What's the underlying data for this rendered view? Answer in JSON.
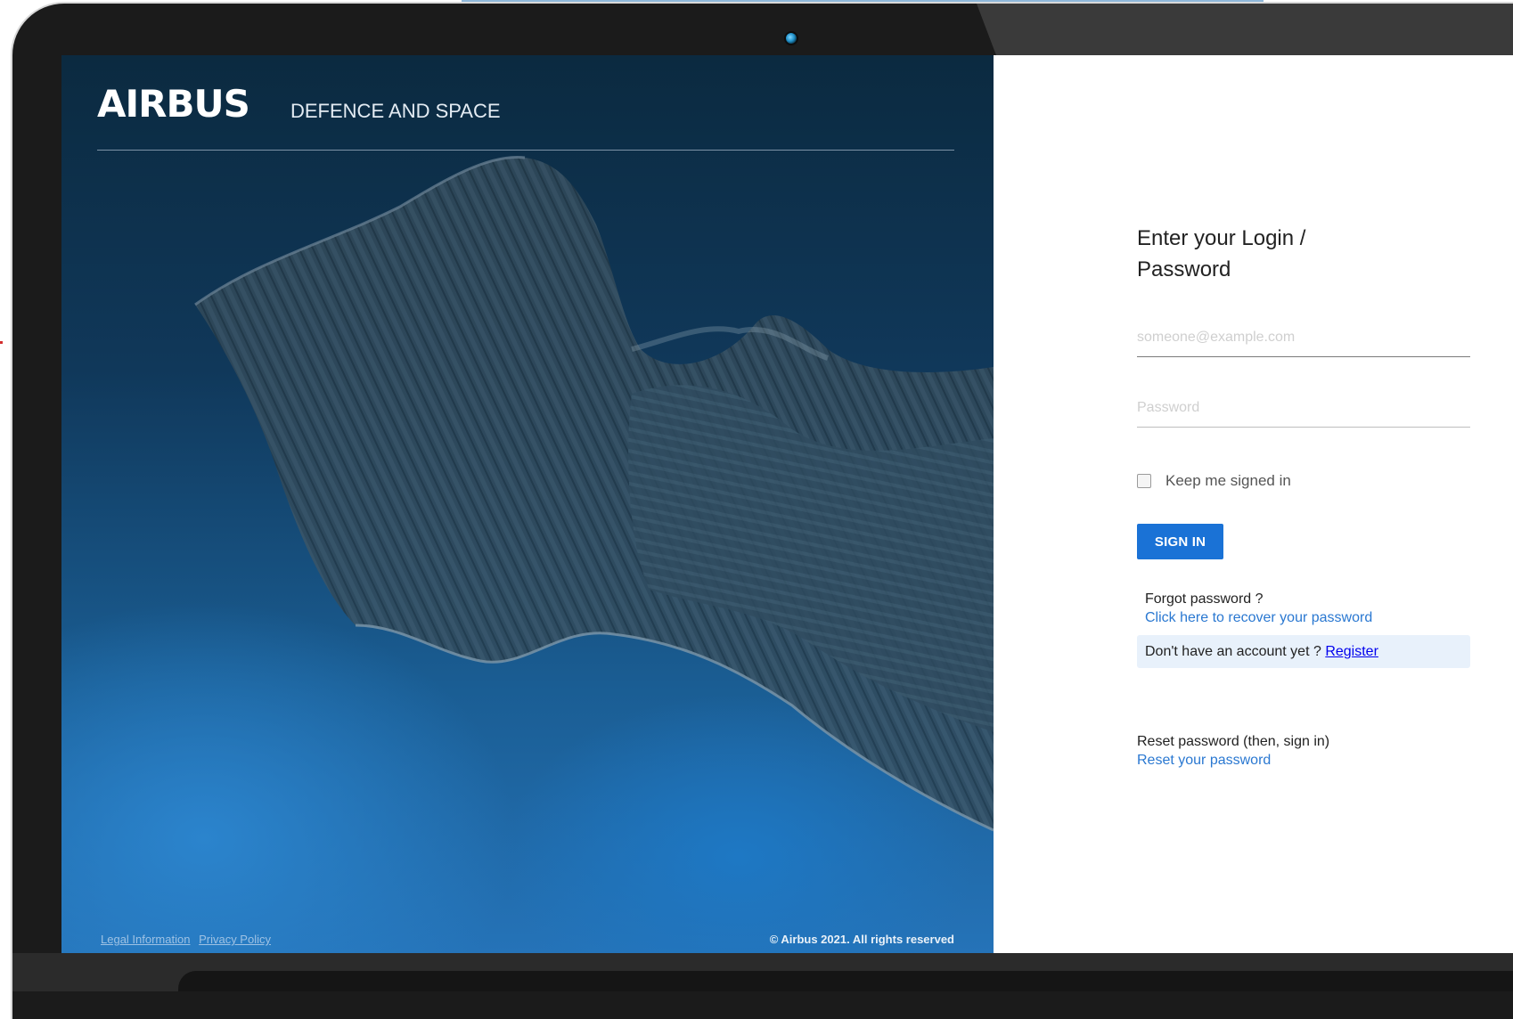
{
  "brand": {
    "logo_text": "AIRBUS",
    "subtitle": "DEFENCE AND SPACE"
  },
  "footer": {
    "legal_label": "Legal Information",
    "privacy_label": "Privacy Policy",
    "copyright": "© Airbus 2021. All rights reserved"
  },
  "login": {
    "title": "Enter your Login / Password",
    "email_placeholder": "someone@example.com",
    "email_value": "",
    "password_placeholder": "Password",
    "password_value": "",
    "keep_signed_in_label": "Keep me signed in",
    "keep_signed_in_checked": false,
    "sign_in_label": "SIGN IN",
    "forgot_text": "Forgot password ?",
    "forgot_link": "Click here to recover your password",
    "no_account_text": "Don't have an account yet ?",
    "register_link": "Register",
    "reset_text": "Reset password (then, sign in)",
    "reset_link": "Reset your password"
  },
  "colors": {
    "accent": "#1a72d6",
    "link": "#2a78d1",
    "register_bg": "#e8f1fb",
    "bezel": "#1b1b1b",
    "camera": "#1f8fc8"
  }
}
